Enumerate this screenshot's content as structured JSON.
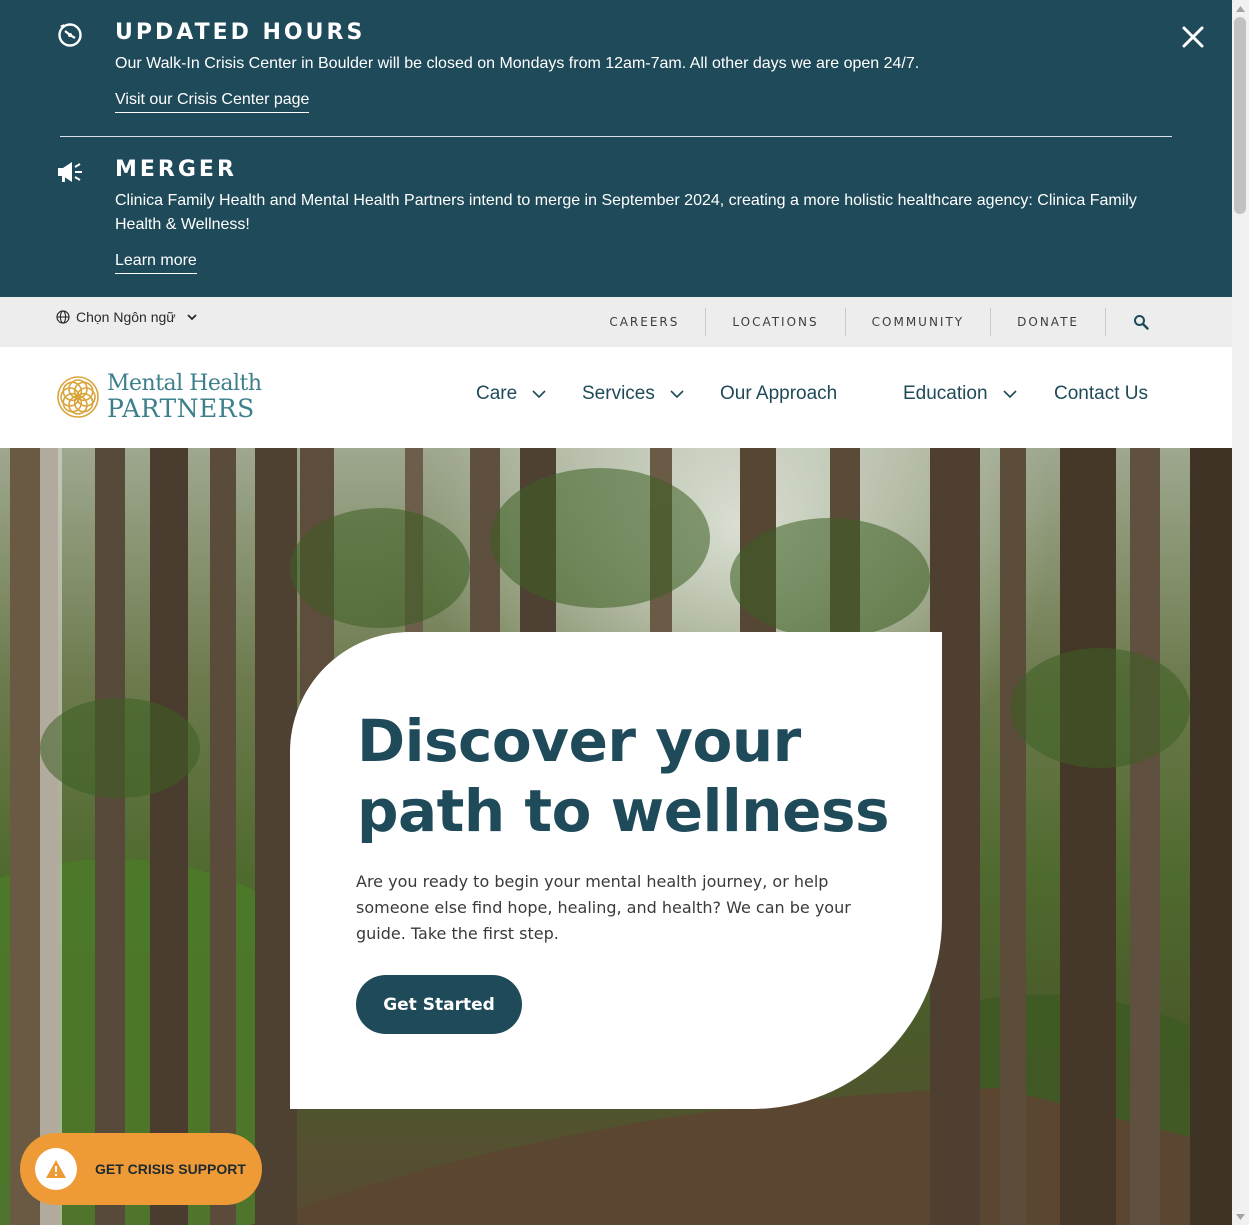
{
  "alerts": [
    {
      "title": "UPDATED HOURS",
      "body": "Our Walk-In Crisis Center in Boulder will be closed on Mondays from 12am-7am. All other days we are open 24/7.",
      "link": "Visit our Crisis Center page",
      "icon": "clock-icon"
    },
    {
      "title": "MERGER",
      "body": "Clinica Family Health and Mental Health Partners intend to merge in September 2024, creating a more holistic healthcare agency: Clinica Family Health & Wellness!",
      "link": "Learn more",
      "icon": "megaphone-icon"
    }
  ],
  "utility": {
    "language_label": "Chọn Ngôn ngữ",
    "links": [
      "CAREERS",
      "LOCATIONS",
      "COMMUNITY",
      "DONATE"
    ]
  },
  "logo": {
    "line1": "Mental Health",
    "line2": "PARTNERS"
  },
  "nav": {
    "items": [
      "Care",
      "Services",
      "Our Approach",
      "Education",
      "Contact Us"
    ]
  },
  "hero": {
    "title": "Discover your path to wellness",
    "text": "Are you ready to begin your mental health journey, or help someone else find hope, healing, and health? We can be your guide. Take the first step.",
    "button": "Get Started"
  },
  "crisis": {
    "label": "GET CRISIS SUPPORT"
  },
  "colors": {
    "primary": "#1f4a59",
    "accent": "#ee9a37",
    "utility_bg": "#ededed"
  }
}
